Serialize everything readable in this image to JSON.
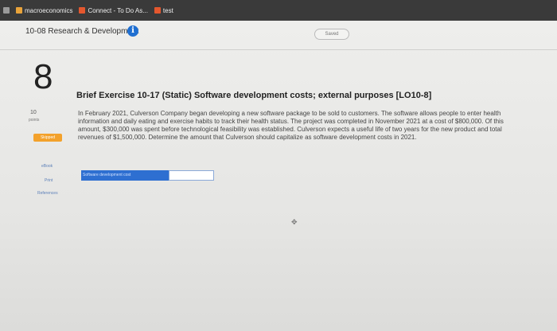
{
  "bookmarks": [
    {
      "label": "macroeconomics",
      "color": "#e9a33a"
    },
    {
      "label": "Connect - To Do As...",
      "color": "#e4572e"
    },
    {
      "label": "test",
      "color": "#e4572e"
    }
  ],
  "assignment": {
    "title": "10-08 Research & Development",
    "saved_label": "Saved"
  },
  "question": {
    "number": "8",
    "title": "Brief Exercise 10-17 (Static) Software development costs; external purposes [LO10-8]",
    "points_value": "10",
    "points_label": "points",
    "status": "Skipped",
    "description": "In February 2021, Culverson Company began developing a new software package to be sold to customers. The software allows people to enter health information and daily eating and exercise habits to track their health status. The project was completed in November 2021 at a cost of $800,000. Of this amount, $300,000 was spent before technological feasibility was established. Culverson expects a useful life of two years for the new product and total revenues of $1,500,000. Determine the amount that Culverson should capitalize as software development costs in 2021."
  },
  "side_links": {
    "ebook": "eBook",
    "print": "Print",
    "references": "References"
  },
  "answer": {
    "label": "Software development cost",
    "value": ""
  },
  "colors": {
    "accent": "#2e6fd1",
    "skipped": "#f3a12b",
    "info": "#1f6fd1"
  }
}
